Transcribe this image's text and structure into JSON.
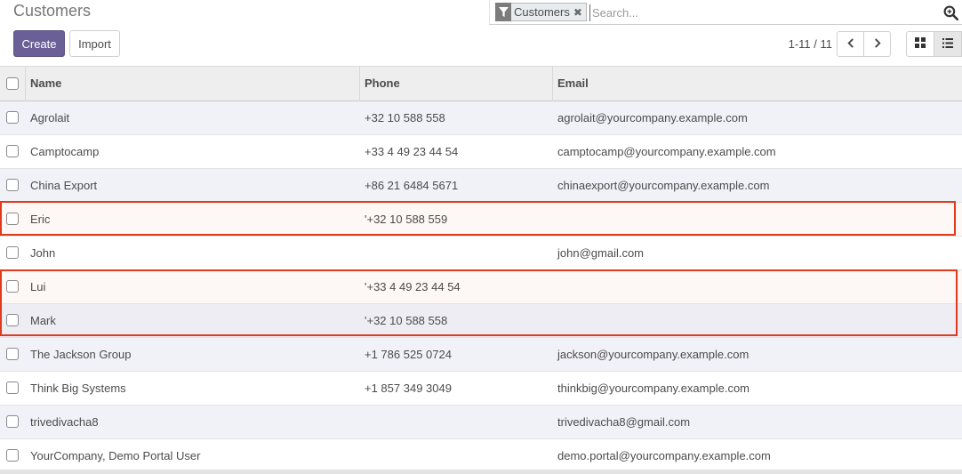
{
  "page": {
    "title": "Customers"
  },
  "search": {
    "facet_label": "Customers",
    "facet_remove": "✖",
    "placeholder": "Search..."
  },
  "toolbar": {
    "create_label": "Create",
    "import_label": "Import"
  },
  "pager": {
    "value": "1-11 / 11"
  },
  "table": {
    "headers": {
      "name": "Name",
      "phone": "Phone",
      "email": "Email"
    },
    "rows": [
      {
        "name": "Agrolait",
        "phone": "+32 10 588 558",
        "email": "agrolait@yourcompany.example.com"
      },
      {
        "name": "Camptocamp",
        "phone": "+33 4 49 23 44 54",
        "email": "camptocamp@yourcompany.example.com"
      },
      {
        "name": "China Export",
        "phone": "+86 21 6484 5671",
        "email": "chinaexport@yourcompany.example.com"
      },
      {
        "name": "Eric",
        "phone": "'+32 10 588 559",
        "email": ""
      },
      {
        "name": "John",
        "phone": "",
        "email": "john@gmail.com"
      },
      {
        "name": "Lui",
        "phone": "'+33 4 49 23 44 54",
        "email": ""
      },
      {
        "name": "Mark",
        "phone": "'+32 10 588 558",
        "email": ""
      },
      {
        "name": "The Jackson Group",
        "phone": "+1 786 525 0724",
        "email": "jackson@yourcompany.example.com"
      },
      {
        "name": "Think Big Systems",
        "phone": "+1 857 349 3049",
        "email": "thinkbig@yourcompany.example.com"
      },
      {
        "name": "trivedivacha8",
        "phone": "",
        "email": "trivedivacha8@gmail.com"
      },
      {
        "name": "YourCompany, Demo Portal User",
        "phone": "",
        "email": "demo.portal@yourcompany.example.com"
      }
    ]
  },
  "colors": {
    "primary": "#6a5f96",
    "highlight_border": "#e0391c",
    "row_stripe": "#f1f1f8"
  },
  "icons": {
    "facet": "filter-icon",
    "search": "search-zoom-icon",
    "pager_prev": "chevron-left-icon",
    "pager_next": "chevron-right-icon",
    "kanban_view": "kanban-view-icon",
    "list_view": "list-view-icon"
  }
}
